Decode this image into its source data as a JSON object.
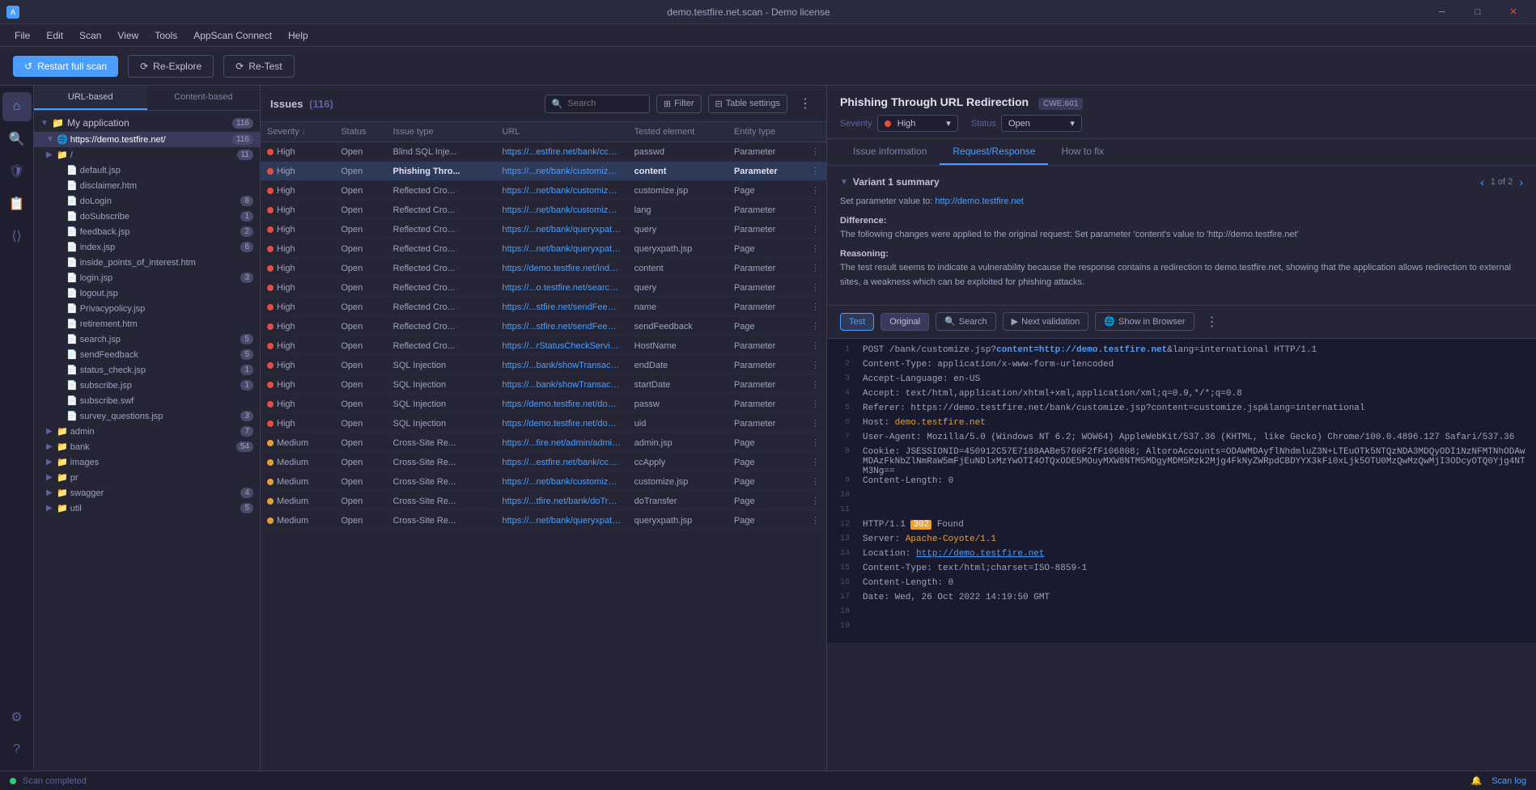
{
  "titlebar": {
    "title": "demo.testfire.net.scan - Demo license",
    "minimize": "–",
    "maximize": "□",
    "close": "✕"
  },
  "menubar": {
    "items": [
      "File",
      "Edit",
      "Scan",
      "View",
      "Tools",
      "AppScan Connect",
      "Help"
    ]
  },
  "toolbar": {
    "restart_label": "Restart full scan",
    "reexplore_label": "Re-Explore",
    "retest_label": "Re-Test"
  },
  "panel_tabs": {
    "url_based": "URL-based",
    "content_based": "Content-based"
  },
  "tree": {
    "root_label": "My application",
    "root_count": "116",
    "root_url": "https://demo.testfire.net/",
    "root_url_count": "116",
    "items": [
      {
        "label": "/",
        "count": "11",
        "indent": 1,
        "type": "folder"
      },
      {
        "label": "default.jsp",
        "count": "",
        "indent": 2,
        "type": "file"
      },
      {
        "label": "disclaimer.htm",
        "count": "",
        "indent": 2,
        "type": "file"
      },
      {
        "label": "doLogin",
        "count": "8",
        "indent": 2,
        "type": "file"
      },
      {
        "label": "doSubscribe",
        "count": "1",
        "indent": 2,
        "type": "file"
      },
      {
        "label": "feedback.jsp",
        "count": "2",
        "indent": 2,
        "type": "file"
      },
      {
        "label": "index.jsp",
        "count": "6",
        "indent": 2,
        "type": "file"
      },
      {
        "label": "inside_points_of_interest.htm",
        "count": "",
        "indent": 2,
        "type": "file"
      },
      {
        "label": "login.jsp",
        "count": "3",
        "indent": 2,
        "type": "file"
      },
      {
        "label": "logout.jsp",
        "count": "",
        "indent": 2,
        "type": "file"
      },
      {
        "label": "Privacypolicy.jsp",
        "count": "",
        "indent": 2,
        "type": "file"
      },
      {
        "label": "retirement.htm",
        "count": "",
        "indent": 2,
        "type": "file"
      },
      {
        "label": "search.jsp",
        "count": "5",
        "indent": 2,
        "type": "file"
      },
      {
        "label": "sendFeedback",
        "count": "5",
        "indent": 2,
        "type": "file"
      },
      {
        "label": "status_check.jsp",
        "count": "1",
        "indent": 2,
        "type": "file"
      },
      {
        "label": "subscribe.jsp",
        "count": "1",
        "indent": 2,
        "type": "file"
      },
      {
        "label": "subscribe.swf",
        "count": "",
        "indent": 2,
        "type": "file"
      },
      {
        "label": "survey_questions.jsp",
        "count": "3",
        "indent": 2,
        "type": "file"
      },
      {
        "label": "admin",
        "count": "7",
        "indent": 1,
        "type": "folder"
      },
      {
        "label": "bank",
        "count": "54",
        "indent": 1,
        "type": "folder"
      },
      {
        "label": "images",
        "count": "",
        "indent": 1,
        "type": "folder"
      },
      {
        "label": "pr",
        "count": "",
        "indent": 1,
        "type": "folder"
      },
      {
        "label": "swagger",
        "count": "4",
        "indent": 1,
        "type": "folder"
      },
      {
        "label": "util",
        "count": "5",
        "indent": 1,
        "type": "folder"
      }
    ]
  },
  "issues": {
    "title": "Issues",
    "count": "116",
    "search_placeholder": "Search",
    "filter_label": "Filter",
    "table_settings_label": "Table settings",
    "columns": [
      "Severity",
      "Status",
      "Issue type",
      "URL",
      "Tested element",
      "Entity type"
    ],
    "rows": [
      {
        "severity": "High",
        "severity_level": "high",
        "status": "Open",
        "issue_type": "Blind SQL Inje...",
        "url": "https://...estfire.net/bank/ccApply",
        "tested_element": "passwd",
        "entity_type": "Parameter",
        "selected": false
      },
      {
        "severity": "High",
        "severity_level": "high",
        "status": "Open",
        "issue_type": "Phishing Thro...",
        "url": "https://...net/bank/customize.jsp",
        "tested_element": "content",
        "entity_type": "Parameter",
        "selected": true
      },
      {
        "severity": "High",
        "severity_level": "high",
        "status": "Open",
        "issue_type": "Reflected Cro...",
        "url": "https://...net/bank/customize.jsp",
        "tested_element": "customize.jsp",
        "entity_type": "Page",
        "selected": false
      },
      {
        "severity": "High",
        "severity_level": "high",
        "status": "Open",
        "issue_type": "Reflected Cro...",
        "url": "https://...net/bank/customize.jsp",
        "tested_element": "lang",
        "entity_type": "Parameter",
        "selected": false
      },
      {
        "severity": "High",
        "severity_level": "high",
        "status": "Open",
        "issue_type": "Reflected Cro...",
        "url": "https://...net/bank/queryxpath.jsp",
        "tested_element": "query",
        "entity_type": "Parameter",
        "selected": false
      },
      {
        "severity": "High",
        "severity_level": "high",
        "status": "Open",
        "issue_type": "Reflected Cro...",
        "url": "https://...net/bank/queryxpath.jsp",
        "tested_element": "queryxpath.jsp",
        "entity_type": "Page",
        "selected": false
      },
      {
        "severity": "High",
        "severity_level": "high",
        "status": "Open",
        "issue_type": "Reflected Cro...",
        "url": "https://demo.testfire.net/index.jsp",
        "tested_element": "content",
        "entity_type": "Parameter",
        "selected": false
      },
      {
        "severity": "High",
        "severity_level": "high",
        "status": "Open",
        "issue_type": "Reflected Cro...",
        "url": "https://...o.testfire.net/search.jsp",
        "tested_element": "query",
        "entity_type": "Parameter",
        "selected": false
      },
      {
        "severity": "High",
        "severity_level": "high",
        "status": "Open",
        "issue_type": "Reflected Cro...",
        "url": "https://...stfire.net/sendFeedback",
        "tested_element": "name",
        "entity_type": "Parameter",
        "selected": false
      },
      {
        "severity": "High",
        "severity_level": "high",
        "status": "Open",
        "issue_type": "Reflected Cro...",
        "url": "https://...stfire.net/sendFeedback",
        "tested_element": "sendFeedback",
        "entity_type": "Page",
        "selected": false
      },
      {
        "severity": "High",
        "severity_level": "high",
        "status": "Open",
        "issue_type": "Reflected Cro...",
        "url": "https://...rStatusCheckService.jsp",
        "tested_element": "HostName",
        "entity_type": "Parameter",
        "selected": false
      },
      {
        "severity": "High",
        "severity_level": "high",
        "status": "Open",
        "issue_type": "SQL Injection",
        "url": "https://...bank/showTransactions",
        "tested_element": "endDate",
        "entity_type": "Parameter",
        "selected": false
      },
      {
        "severity": "High",
        "severity_level": "high",
        "status": "Open",
        "issue_type": "SQL Injection",
        "url": "https://...bank/showTransactions",
        "tested_element": "startDate",
        "entity_type": "Parameter",
        "selected": false
      },
      {
        "severity": "High",
        "severity_level": "high",
        "status": "Open",
        "issue_type": "SQL Injection",
        "url": "https://demo.testfire.net/doLogin",
        "tested_element": "passw",
        "entity_type": "Parameter",
        "selected": false
      },
      {
        "severity": "High",
        "severity_level": "high",
        "status": "Open",
        "issue_type": "SQL Injection",
        "url": "https://demo.testfire.net/doLogin",
        "tested_element": "uid",
        "entity_type": "Parameter",
        "selected": false
      },
      {
        "severity": "Medium",
        "severity_level": "medium",
        "status": "Open",
        "issue_type": "Cross-Site Re...",
        "url": "https://...fire.net/admin/admin.jsp",
        "tested_element": "admin.jsp",
        "entity_type": "Page",
        "selected": false
      },
      {
        "severity": "Medium",
        "severity_level": "medium",
        "status": "Open",
        "issue_type": "Cross-Site Re...",
        "url": "https://...estfire.net/bank/ccApply",
        "tested_element": "ccApply",
        "entity_type": "Page",
        "selected": false
      },
      {
        "severity": "Medium",
        "severity_level": "medium",
        "status": "Open",
        "issue_type": "Cross-Site Re...",
        "url": "https://...net/bank/customize.jsp",
        "tested_element": "customize.jsp",
        "entity_type": "Page",
        "selected": false
      },
      {
        "severity": "Medium",
        "severity_level": "medium",
        "status": "Open",
        "issue_type": "Cross-Site Re...",
        "url": "https://...tfire.net/bank/doTransfer",
        "tested_element": "doTransfer",
        "entity_type": "Page",
        "selected": false
      },
      {
        "severity": "Medium",
        "severity_level": "medium",
        "status": "Open",
        "issue_type": "Cross-Site Re...",
        "url": "https://...net/bank/queryxpath.jsp",
        "tested_element": "queryxpath.jsp",
        "entity_type": "Page",
        "selected": false
      }
    ]
  },
  "detail": {
    "title": "Phishing Through URL Redirection",
    "cwe": "CWE:601",
    "severity_label": "Severity",
    "severity_value": "High",
    "status_label": "Status",
    "status_value": "Open",
    "tabs": [
      "Issue information",
      "Request/Response",
      "How to fix"
    ],
    "active_tab": "Request/Response",
    "variant": {
      "title": "Variant 1 summary",
      "nav": "1 of 2",
      "set_param_label": "Set parameter value to:",
      "set_param_value": "http://demo.testfire.net",
      "difference_label": "Difference:",
      "difference_text": "The following changes were applied to the original request:\nSet parameter 'content's value to 'http://demo.testfire.net'",
      "reasoning_label": "Reasoning:",
      "reasoning_text": "The test result seems to indicate a vulnerability because the response contains a redirection to demo.testfire.net, showing that the application allows redirection to external sites, a weakness which can be exploited for phishing attacks."
    },
    "req_resp": {
      "test_label": "Test",
      "original_label": "Original",
      "search_label": "Search",
      "next_validation_label": "Next validation",
      "show_browser_label": "Show in Browser",
      "code_lines": [
        {
          "num": "1",
          "content": "POST /bank/customize.jsp?",
          "highlight_content": "content=http://demo.testfire.net",
          "suffix": "&lang=international HTTP/1.1"
        },
        {
          "num": "2",
          "content": "Content-Type: application/x-www-form-urlencoded"
        },
        {
          "num": "3",
          "content": "Accept-Language: en-US"
        },
        {
          "num": "4",
          "content": "Accept: text/html,application/xhtml+xml,application/xml;q=0.9,*/*;q=0.8"
        },
        {
          "num": "5",
          "content": "Referer: https://demo.testfire.net/bank/customize.jsp?content=customize.jsp&lang=international"
        },
        {
          "num": "6",
          "content": "Host: demo.testfire.net"
        },
        {
          "num": "7",
          "content": "User-Agent: Mozilla/5.0 (Windows NT 6.2; WOW64) AppleWebKit/537.36 (KHTML, like Gecko) Chrome/100.0.4896.127 Safari/537.36"
        },
        {
          "num": "8",
          "content": "Cookie: JSESSIONID=450912C57E7188AABe5760F2fF106808; AltoroAccounts=ODAWMDAyflNhdmluZ3N+LTEuOTk5NTQzNDA3MDQyODI1NzNFMTNhODAwMDAzFkNbZlNmRaW5mFjEuNDlxMzYwOTI4OTQxODE5MOuyMXW8NTM5MDgyMDM5Mzk2Mjg4FkNyZWRpdCBDYYX3kFi0xLjk5OTU0MzQwMzQwMjI3ODcyOTQ0Yjg4NTM3Ng=="
        },
        {
          "num": "9",
          "content": "Content-Length: 0"
        },
        {
          "num": "10",
          "content": ""
        },
        {
          "num": "11",
          "content": ""
        },
        {
          "num": "12",
          "content": "HTTP/1.1 302 Found"
        },
        {
          "num": "13",
          "content": "Server: Apache-Coyote/1.1"
        },
        {
          "num": "14",
          "content": "Location: http://demo.testfire.net"
        },
        {
          "num": "15",
          "content": "Content-Type: text/html;charset=ISO-8859-1"
        },
        {
          "num": "16",
          "content": "Content-Length: 0"
        },
        {
          "num": "17",
          "content": "Date: Wed, 26 Oct 2022 14:19:50 GMT"
        },
        {
          "num": "18",
          "content": ""
        },
        {
          "num": "19",
          "content": ""
        }
      ]
    }
  },
  "statusbar": {
    "scan_completed": "Scan completed",
    "scan_log": "Scan log",
    "date": "Wed, 26 Oct 2022 14:19:50 GMT"
  }
}
